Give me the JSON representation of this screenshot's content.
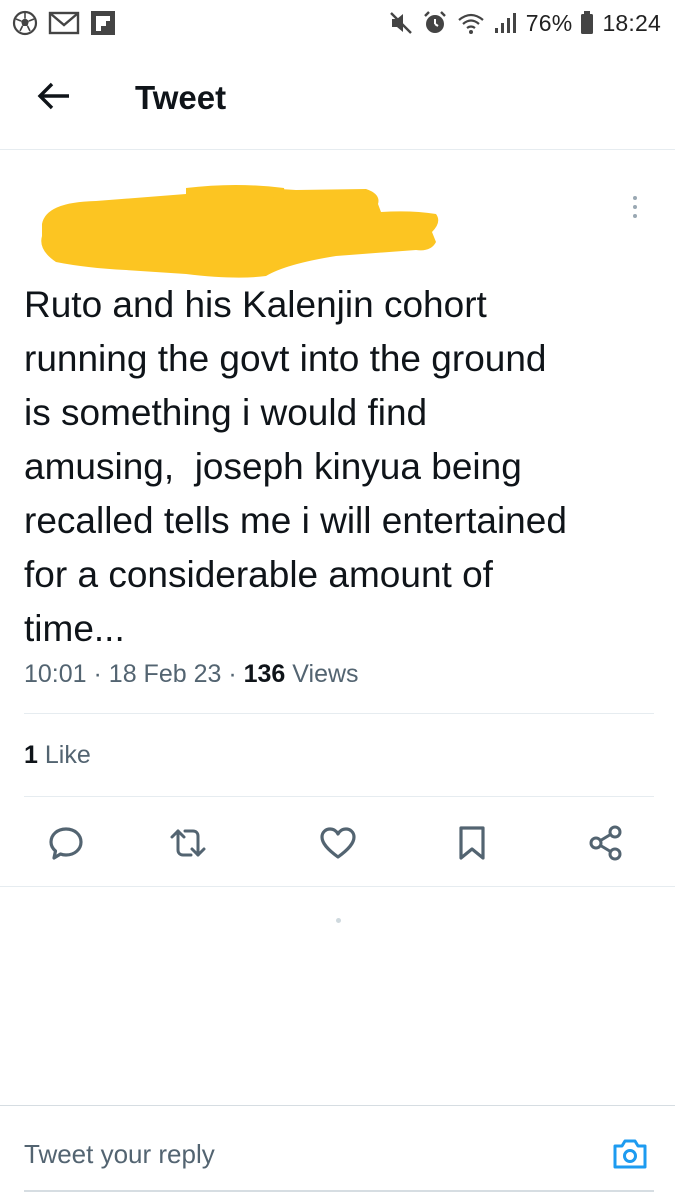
{
  "status_bar": {
    "left_icons": [
      "soccer-ball-icon",
      "gmail-icon",
      "flipboard-icon"
    ],
    "right_icons": [
      "mute-icon",
      "alarm-icon",
      "wifi-icon",
      "signal-icon",
      "battery-icon"
    ],
    "battery": "76%",
    "time": "18:24"
  },
  "header": {
    "back_icon": "arrow-left-icon",
    "title": "Tweet"
  },
  "tweet": {
    "text": "Ruto and his Kalenjin cohort\nrunning the govt into the ground\nis something i would find\namusing,  joseph kinyua being\nrecalled tells me i will entertained\nfor a considerable amount of\ntime...",
    "time": "10:01",
    "date": "18 Feb 23",
    "views_count": "136",
    "views_label": "Views",
    "meta_separator": "·",
    "likes_count": "1",
    "likes_label": "Like",
    "redaction_color": "#fcc522"
  },
  "actions": [
    {
      "name": "reply",
      "icon": "comment-icon"
    },
    {
      "name": "retweet",
      "icon": "retweet-icon"
    },
    {
      "name": "like",
      "icon": "heart-icon"
    },
    {
      "name": "bookmark",
      "icon": "bookmark-icon"
    },
    {
      "name": "share",
      "icon": "share-icon"
    }
  ],
  "reply_bar": {
    "placeholder": "Tweet your reply",
    "camera_icon": "camera-icon",
    "accent_color": "#1d9bf0"
  },
  "colors": {
    "text_primary": "#0f1419",
    "text_secondary": "#536471",
    "icon_gray": "#536471",
    "divider": "#e6ecf0"
  }
}
